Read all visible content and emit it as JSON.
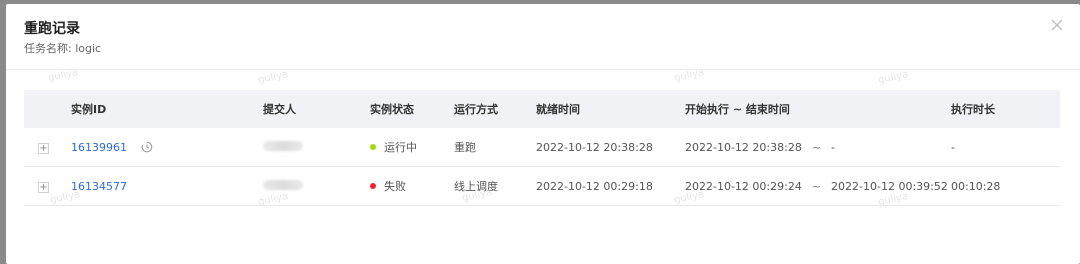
{
  "modal": {
    "title": "重跑记录",
    "subtitle": "任务名称: logic",
    "close_icon": "close-icon"
  },
  "watermark": "guliya",
  "table": {
    "headers": [
      "",
      "实例ID",
      "提交人",
      "实例状态",
      "运行方式",
      "就绪时间",
      "开始执行 ~ 结束时间",
      "执行时长"
    ],
    "rows": [
      {
        "expand": "+",
        "instance_id": "16139961",
        "status": "运行中",
        "status_color": "#a0d911",
        "run_mode": "重跑",
        "ready_time": "2022-10-12 20:38:28",
        "start_time": "2022-10-12 20:38:28",
        "tilde": "~",
        "end_time": "-",
        "duration": "-"
      },
      {
        "expand": "+",
        "instance_id": "16134577",
        "status": "失败",
        "status_color": "#f5222d",
        "run_mode": "线上调度",
        "ready_time": "2022-10-12 00:29:18",
        "start_time": "2022-10-12 00:29:24",
        "tilde": "~",
        "end_time": "2022-10-12 00:39:52",
        "duration": "00:10:28"
      }
    ]
  }
}
